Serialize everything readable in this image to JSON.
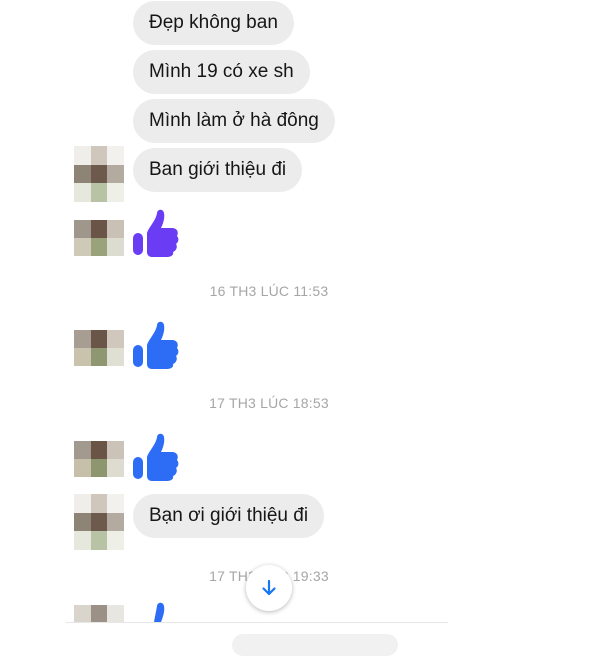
{
  "messages": [
    {
      "text": "Đẹp không ban"
    },
    {
      "text": "Mình 19 có xe sh"
    },
    {
      "text": "Mình làm ở hà đông"
    },
    {
      "text": "Ban giới thiệu đi"
    },
    {
      "text": "Bạn ơi giới thiệu đi"
    }
  ],
  "timestamps": [
    {
      "text": "16 TH3 LÚC 11:53"
    },
    {
      "text": "17 TH3 LÚC 18:53"
    },
    {
      "text": "17 TH3 LÚC 19:33"
    }
  ],
  "icons": {
    "like": "thumbs-up-icon",
    "scroll_down": "arrow-down-icon",
    "avatar": "pixelated-avatar"
  },
  "colors": {
    "like_purple": "#6a3df5",
    "like_blue": "#2d6df5",
    "bubble_bg": "#ececec",
    "accent": "#1877f2"
  }
}
